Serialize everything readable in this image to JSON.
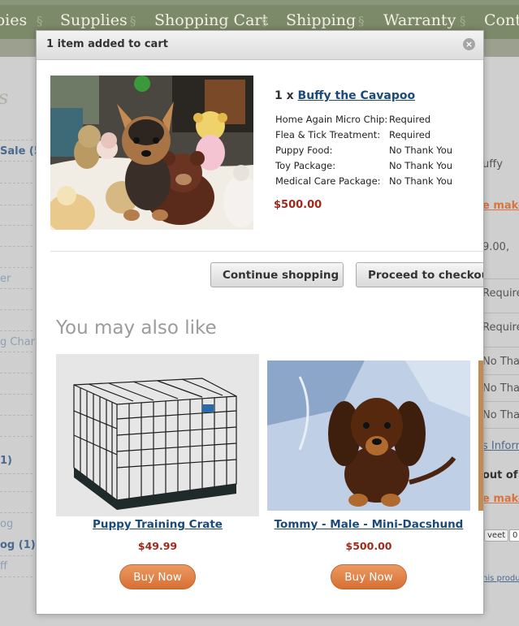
{
  "nav": {
    "items": [
      "pies",
      "Supplies",
      "Shopping Cart",
      "Shipping",
      "Warranty",
      "Conta"
    ],
    "separator": "§"
  },
  "background": {
    "left": [
      "s",
      "Sale (5",
      "er",
      "g Charl",
      "1)",
      "og",
      "og (1)",
      "ff"
    ],
    "right": [
      "uffy",
      "e make",
      "9.00,",
      "Require",
      "Require",
      "No Tha",
      "No Tha",
      "No Tha",
      "s Inform",
      "out of s",
      "e make",
      "veet",
      "0",
      "his produ"
    ]
  },
  "modal": {
    "title": "1 item added to cart",
    "close_label": "×",
    "product": {
      "qty": "1 x",
      "name": "Buffy the Cavapoo",
      "price": "$500.00",
      "options": [
        {
          "label": "Home Again Micro Chip:",
          "value": "Required"
        },
        {
          "label": "Flea & Tick Treatment:",
          "value": "Required"
        },
        {
          "label": "Puppy Food:",
          "value": "No Thank You"
        },
        {
          "label": "Toy Package:",
          "value": "No Thank You"
        },
        {
          "label": "Medical Care Package:",
          "value": "No Thank You"
        }
      ]
    },
    "continue_label": "Continue shopping",
    "checkout_label": "Proceed to checkout",
    "also_like_heading": "You may also like",
    "recommendations": [
      {
        "name": "Puppy Training Crate",
        "price": "$49.99",
        "button": "Buy Now"
      },
      {
        "name": "Tommy - Male - Mini-Dacshund",
        "price": "$500.00",
        "button": "Buy Now"
      }
    ]
  },
  "colors": {
    "nav_bg": "#7d8a6a",
    "link": "#1a4a7a",
    "price": "#a0291c",
    "buy_button": "#e0804a",
    "bg_link": "#4b6a8f"
  }
}
